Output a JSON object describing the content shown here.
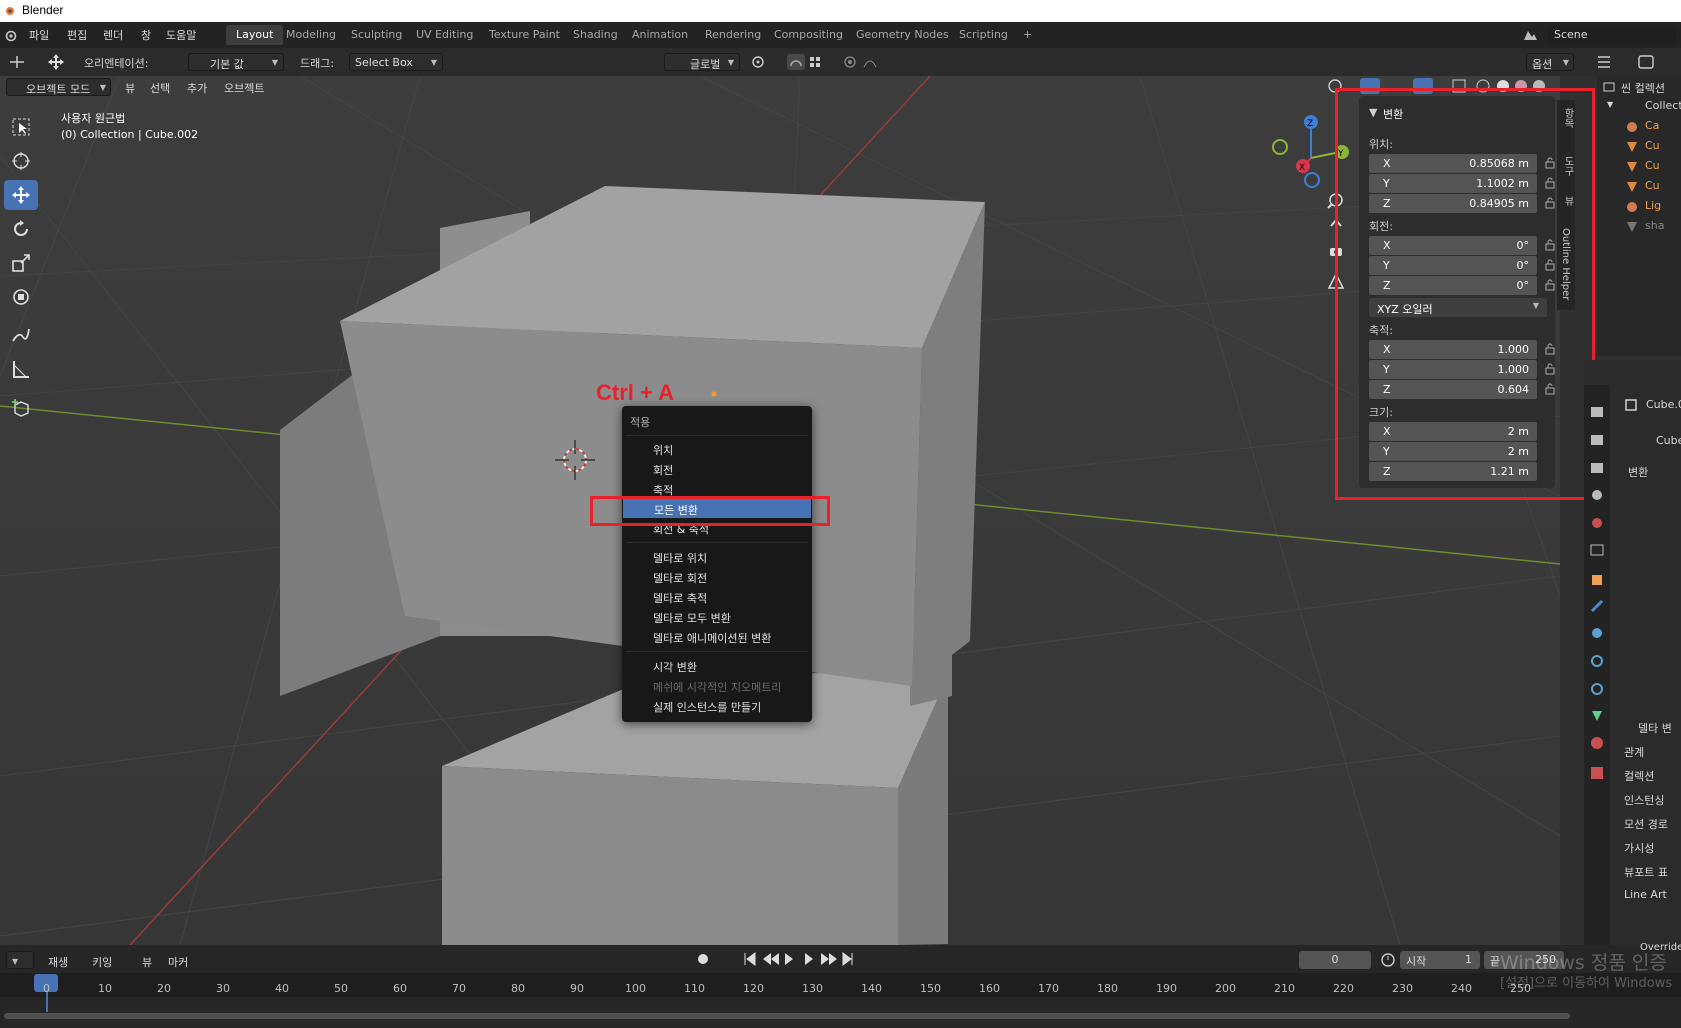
{
  "window": {
    "title": "Blender"
  },
  "menu": [
    "파일",
    "편집",
    "렌더",
    "창",
    "도움말"
  ],
  "workspaces": [
    "Layout",
    "Modeling",
    "Sculpting",
    "UV Editing",
    "Texture Paint",
    "Shading",
    "Animation",
    "Rendering",
    "Compositing",
    "Geometry Nodes",
    "Scripting",
    "+"
  ],
  "scene": "Scene",
  "tool_header": {
    "orientation_label": "오리엔테이션:",
    "orientation_value": "기본 값",
    "drag_label": "드래그:",
    "drag_value": "Select Box",
    "transform_orientation": "글로벌",
    "options": "옵션"
  },
  "viewport_header": {
    "mode": "오브젝트 모드",
    "menus": [
      "뷰",
      "선택",
      "추가",
      "오브젝트"
    ]
  },
  "viewport_info": {
    "line1": "사용자 원근법",
    "line2": "(0) Collection | Cube.002"
  },
  "annotation": {
    "text": "Ctrl + A"
  },
  "apply_menu": {
    "title": "적용",
    "items": [
      "위치",
      "회전",
      "축적",
      "모든 변환",
      "회전 & 축적"
    ],
    "delta_items": [
      "델타로 위치",
      "델타로 회전",
      "델타로 축적",
      "델타로 모두 변환",
      "델타로 애니메이션된 변환"
    ],
    "other_items": [
      "시각 변환",
      "메쉬에 시각적인 지오메트리",
      "실제 인스턴스를 만들기"
    ],
    "selected": "모든 변환"
  },
  "transform_panel": {
    "header": "변환",
    "location_label": "위치:",
    "location": [
      [
        "X",
        "0.85068 m"
      ],
      [
        "Y",
        "1.1002 m"
      ],
      [
        "Z",
        "0.84905 m"
      ]
    ],
    "rotation_label": "회전:",
    "rotation": [
      [
        "X",
        "0°"
      ],
      [
        "Y",
        "0°"
      ],
      [
        "Z",
        "0°"
      ]
    ],
    "rotation_mode": "XYZ 오일러",
    "scale_label": "축적:",
    "scale": [
      [
        "X",
        "1.000"
      ],
      [
        "Y",
        "1.000"
      ],
      [
        "Z",
        "0.604"
      ]
    ],
    "dimensions_label": "크기:",
    "dimensions": [
      [
        "X",
        "2 m"
      ],
      [
        "Y",
        "2 m"
      ],
      [
        "Z",
        "1.21 m"
      ]
    ]
  },
  "side_tabs": [
    "항목",
    "도구",
    "뷰",
    "Outline Helper"
  ],
  "outliner": {
    "title": "씬 컬렉션",
    "items": [
      "Collect",
      "Ca",
      "Cu",
      "Cu",
      "Cu",
      "Lig",
      "sha"
    ]
  },
  "properties": {
    "object_name": "Cube.0",
    "data_name": "Cube",
    "sections": [
      "변환",
      "델타 변",
      "관계",
      "컬렉션",
      "인스턴싱",
      "모션 경로",
      "가시성",
      "뷰포트 표",
      "Line Art"
    ],
    "override": "Override"
  },
  "timeline": {
    "menus": [
      "재생",
      "키잉",
      "뷰",
      "마커"
    ],
    "current_frame": "0",
    "start_label": "시작",
    "start": "1",
    "end_label": "끝",
    "end": "250",
    "ticks": [
      "0",
      "10",
      "20",
      "30",
      "40",
      "50",
      "60",
      "70",
      "80",
      "90",
      "100",
      "110",
      "120",
      "130",
      "140",
      "150",
      "160",
      "170",
      "180",
      "190",
      "200",
      "210",
      "220",
      "230",
      "240",
      "250"
    ]
  },
  "watermark": {
    "line1": "Windows 정품 인증",
    "line2": "[설정]으로 이동하여 Windows"
  }
}
